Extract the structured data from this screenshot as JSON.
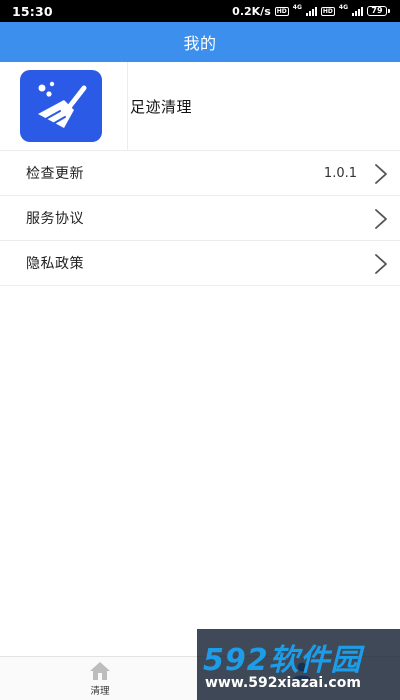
{
  "status_bar": {
    "time": "15:30",
    "net_speed": "0.2K/s",
    "hd_badge": "HD",
    "network_type": "4G",
    "battery_level": "79"
  },
  "header": {
    "title": "我的"
  },
  "profile": {
    "icon": "broom-icon",
    "app_name": "足迹清理"
  },
  "menu": {
    "items": [
      {
        "label": "检查更新",
        "value": "1.0.1",
        "icon": "chevron-right-icon"
      },
      {
        "label": "服务协议",
        "icon": "chevron-right-icon"
      },
      {
        "label": "隐私政策",
        "icon": "chevron-right-icon"
      }
    ]
  },
  "bottom_nav": {
    "tabs": [
      {
        "label": "清理",
        "icon": "home-icon"
      }
    ]
  },
  "watermark": {
    "brand": "592软件园",
    "url": "www.592xiazai.com"
  },
  "colors": {
    "title_bar": "#3d8fed",
    "app_icon_bg": "#2a5ae6",
    "watermark_brand": "#1d9de8"
  }
}
